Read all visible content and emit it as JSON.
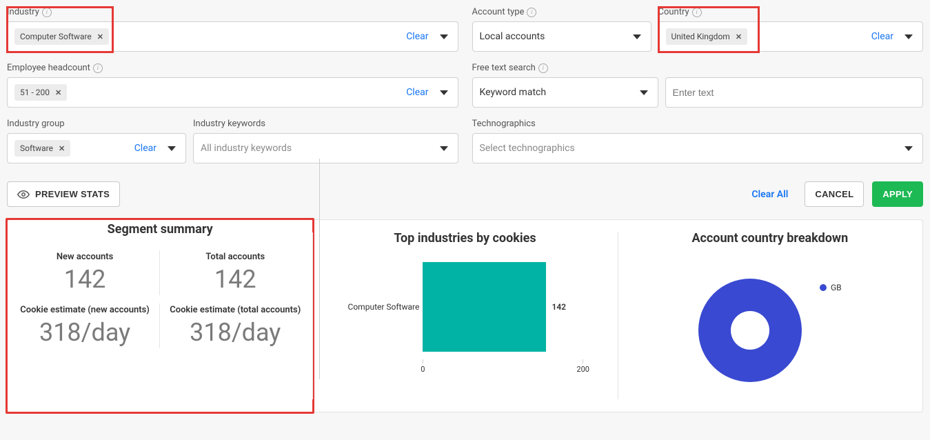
{
  "filters": {
    "industry": {
      "label": "Industry",
      "chip": "Computer Software",
      "clear": "Clear"
    },
    "account_type": {
      "label": "Account type",
      "value": "Local accounts"
    },
    "country": {
      "label": "Country",
      "chip": "United Kingdom",
      "clear": "Clear"
    },
    "employee_headcount": {
      "label": "Employee headcount",
      "chip": "51 - 200",
      "clear": "Clear"
    },
    "free_text": {
      "label": "Free text search",
      "match_label": "Keyword match",
      "placeholder": "Enter text"
    },
    "industry_group": {
      "label": "Industry group",
      "chip": "Software",
      "clear": "Clear"
    },
    "industry_keywords": {
      "label": "Industry keywords",
      "placeholder": "All industry keywords"
    },
    "technographics": {
      "label": "Technographics",
      "placeholder": "Select technographics"
    }
  },
  "actions": {
    "preview_stats": "PREVIEW STATS",
    "clear_all": "Clear All",
    "cancel": "CANCEL",
    "apply": "APPLY"
  },
  "summary": {
    "title": "Segment summary",
    "new_accounts_label": "New accounts",
    "new_accounts_value": "142",
    "total_accounts_label": "Total accounts",
    "total_accounts_value": "142",
    "cookie_new_label": "Cookie estimate (new accounts)",
    "cookie_new_value": "318/day",
    "cookie_total_label": "Cookie estimate (total accounts)",
    "cookie_total_value": "318/day"
  },
  "top_industries": {
    "title": "Top industries by cookies"
  },
  "country_breakdown": {
    "title": "Account country breakdown",
    "legend": "GB"
  },
  "chart_data": [
    {
      "type": "bar",
      "orientation": "horizontal",
      "title": "Top industries by cookies",
      "categories": [
        "Computer Software"
      ],
      "values": [
        142
      ],
      "xlabel": "",
      "ylabel": "",
      "xlim": [
        0,
        200
      ],
      "ticks": [
        0,
        200
      ]
    },
    {
      "type": "pie",
      "title": "Account country breakdown",
      "series": [
        {
          "name": "GB",
          "value": 100,
          "color": "#3949d1"
        }
      ]
    }
  ]
}
